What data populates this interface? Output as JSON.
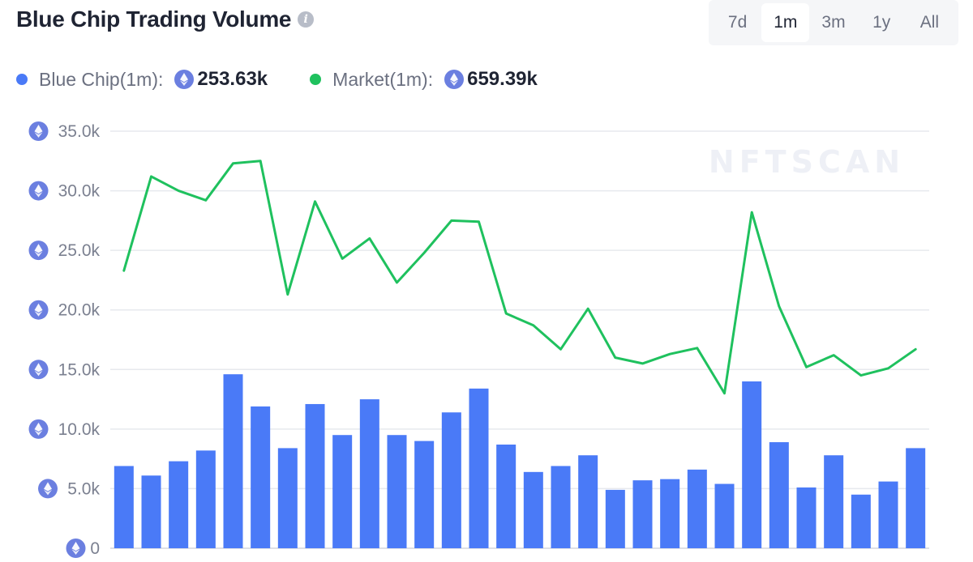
{
  "header": {
    "title": "Blue Chip Trading Volume",
    "info_icon": "info-icon"
  },
  "range_tabs": {
    "items": [
      "7d",
      "1m",
      "3m",
      "1y",
      "All"
    ],
    "active": "1m"
  },
  "legend": {
    "blue_chip": {
      "label": "Blue Chip(1m):",
      "value": "253.63k",
      "color": "#4a7af7",
      "icon": "eth-icon"
    },
    "market": {
      "label": "Market(1m):",
      "value": "659.39k",
      "color": "#1fc15e",
      "icon": "eth-icon"
    }
  },
  "watermark": "NFTSCAN",
  "chart_data": {
    "type": "bar+line",
    "y_ticks": [
      "0",
      "5.0k",
      "10.0k",
      "15.0k",
      "20.0k",
      "25.0k",
      "30.0k",
      "35.0k"
    ],
    "ylim": [
      0,
      35000
    ],
    "grid": true,
    "series": [
      {
        "name": "Blue Chip(1m)",
        "type": "bar",
        "color": "#4a7af7",
        "values": [
          6900,
          6100,
          7300,
          8200,
          14600,
          11900,
          8400,
          12100,
          9500,
          12500,
          9500,
          9000,
          11400,
          13400,
          8700,
          6400,
          6900,
          7800,
          4900,
          5700,
          5800,
          6600,
          5400,
          14000,
          8900,
          5100,
          7800,
          4500,
          5600,
          8400
        ]
      },
      {
        "name": "Market(1m)",
        "type": "line",
        "color": "#1fc15e",
        "values": [
          23300,
          31200,
          30000,
          29200,
          32300,
          32500,
          21300,
          29100,
          24300,
          26000,
          22300,
          24800,
          27500,
          27400,
          19700,
          18700,
          16700,
          20100,
          16000,
          15500,
          16300,
          16800,
          13000,
          28200,
          20300,
          15200,
          16200,
          14500,
          15100,
          16700
        ]
      }
    ]
  }
}
